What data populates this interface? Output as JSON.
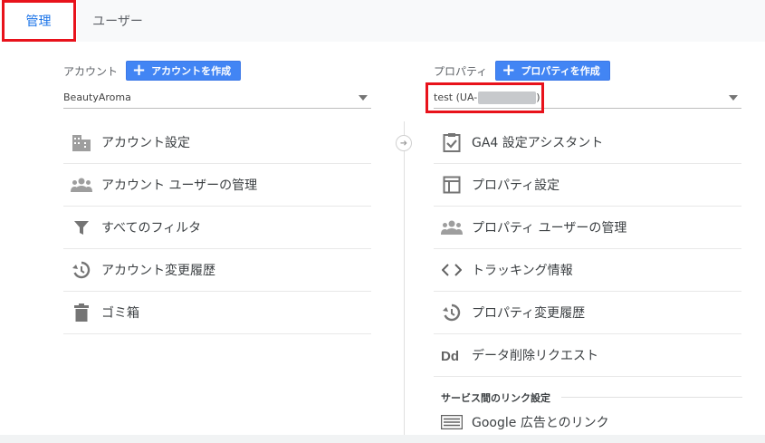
{
  "tabs": {
    "admin": "管理",
    "user": "ユーザー"
  },
  "account": {
    "header_label": "アカウント",
    "create_button": "アカウントを作成",
    "selected": "BeautyAroma",
    "menu": [
      {
        "label": "アカウント設定",
        "icon": "building-icon"
      },
      {
        "label": "アカウント ユーザーの管理",
        "icon": "users-icon"
      },
      {
        "label": "すべてのフィルタ",
        "icon": "filter-icon"
      },
      {
        "label": "アカウント変更履歴",
        "icon": "history-icon"
      },
      {
        "label": "ゴミ箱",
        "icon": "trash-icon"
      }
    ]
  },
  "property": {
    "header_label": "プロパティ",
    "create_button": "プロパティを作成",
    "selected_prefix": "test (UA-",
    "selected_suffix": ")",
    "menu": [
      {
        "label": "GA4 設定アシスタント",
        "icon": "clipboard-check-icon"
      },
      {
        "label": "プロパティ設定",
        "icon": "layout-icon"
      },
      {
        "label": "プロパティ ユーザーの管理",
        "icon": "users-icon"
      },
      {
        "label": "トラッキング情報",
        "icon": "code-icon"
      },
      {
        "label": "プロパティ変更履歴",
        "icon": "history-icon"
      },
      {
        "label": "データ削除リクエスト",
        "icon": "dd-icon"
      }
    ],
    "section_title": "サービス間のリンク設定",
    "link_item": "Google 広告とのリンク"
  },
  "colors": {
    "accent_blue": "#4285f4",
    "highlight_red": "#e8121b"
  }
}
